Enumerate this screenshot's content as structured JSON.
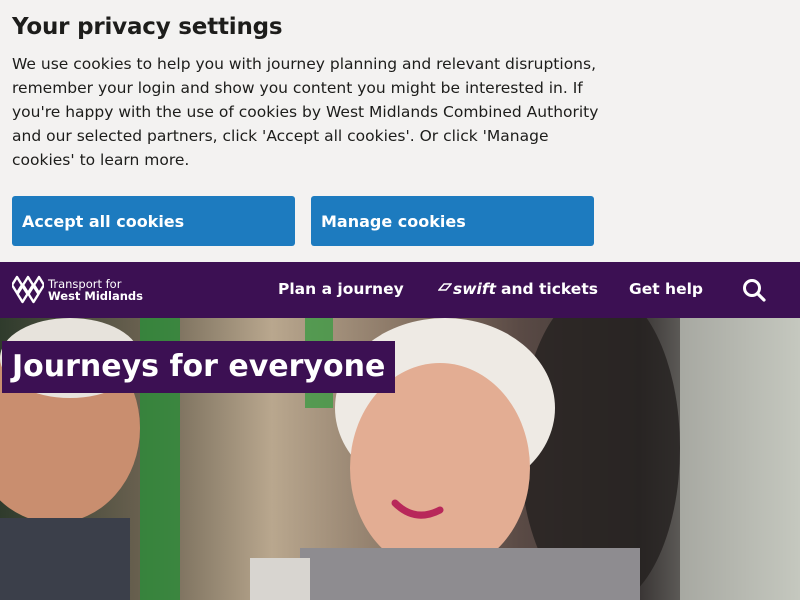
{
  "cookie_banner": {
    "title": "Your privacy settings",
    "body": "We use cookies to help you with journey planning and relevant disruptions, remember your login and show you content you might be interested in. If you're happy with the use of cookies by West Midlands Combined Authority and our selected partners, click 'Accept all cookies'. Or click 'Manage cookies' to learn more.",
    "accept_label": "Accept all cookies",
    "manage_label": "Manage cookies"
  },
  "header": {
    "logo_line1": "Transport for",
    "logo_line2": "West Midlands",
    "nav": {
      "plan": "Plan a journey",
      "swift_brand": "swift",
      "swift_rest": "and tickets",
      "help": "Get help"
    },
    "search_icon": "search-icon"
  },
  "hero": {
    "title": "Journeys for everyone"
  },
  "colors": {
    "brand_purple": "#3c1053",
    "button_blue": "#1d7bbf",
    "banner_bg": "#f3f2f1"
  }
}
